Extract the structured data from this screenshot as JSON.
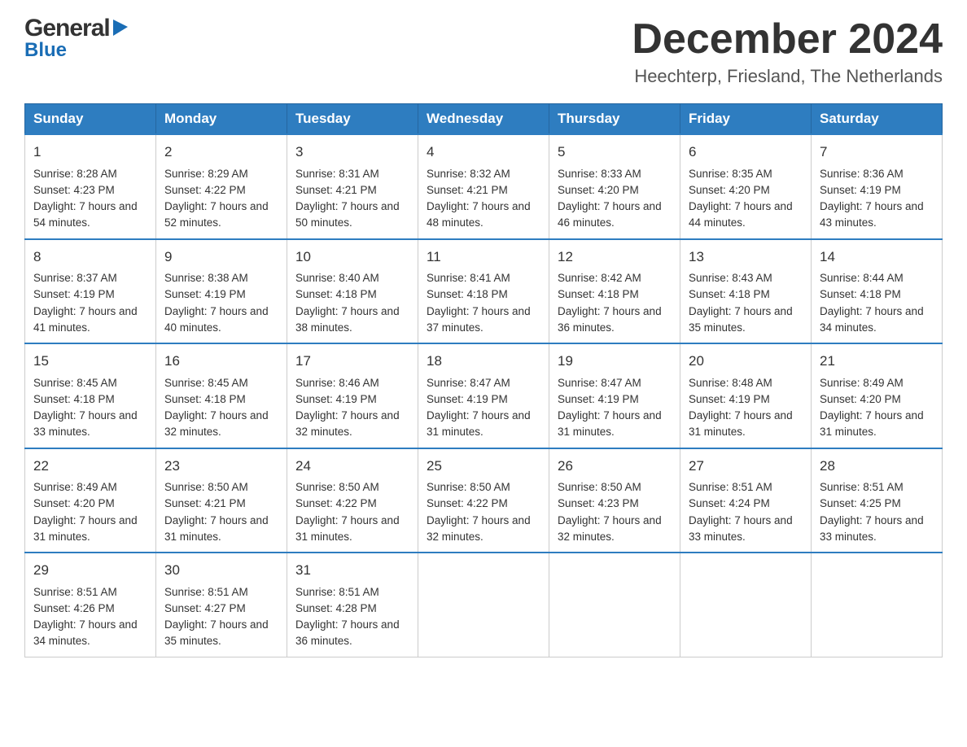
{
  "header": {
    "logo_general": "General",
    "logo_blue": "Blue",
    "month_year": "December 2024",
    "location": "Heechterp, Friesland, The Netherlands"
  },
  "weekdays": [
    "Sunday",
    "Monday",
    "Tuesday",
    "Wednesday",
    "Thursday",
    "Friday",
    "Saturday"
  ],
  "weeks": [
    [
      {
        "day": "1",
        "sunrise": "Sunrise: 8:28 AM",
        "sunset": "Sunset: 4:23 PM",
        "daylight": "Daylight: 7 hours and 54 minutes."
      },
      {
        "day": "2",
        "sunrise": "Sunrise: 8:29 AM",
        "sunset": "Sunset: 4:22 PM",
        "daylight": "Daylight: 7 hours and 52 minutes."
      },
      {
        "day": "3",
        "sunrise": "Sunrise: 8:31 AM",
        "sunset": "Sunset: 4:21 PM",
        "daylight": "Daylight: 7 hours and 50 minutes."
      },
      {
        "day": "4",
        "sunrise": "Sunrise: 8:32 AM",
        "sunset": "Sunset: 4:21 PM",
        "daylight": "Daylight: 7 hours and 48 minutes."
      },
      {
        "day": "5",
        "sunrise": "Sunrise: 8:33 AM",
        "sunset": "Sunset: 4:20 PM",
        "daylight": "Daylight: 7 hours and 46 minutes."
      },
      {
        "day": "6",
        "sunrise": "Sunrise: 8:35 AM",
        "sunset": "Sunset: 4:20 PM",
        "daylight": "Daylight: 7 hours and 44 minutes."
      },
      {
        "day": "7",
        "sunrise": "Sunrise: 8:36 AM",
        "sunset": "Sunset: 4:19 PM",
        "daylight": "Daylight: 7 hours and 43 minutes."
      }
    ],
    [
      {
        "day": "8",
        "sunrise": "Sunrise: 8:37 AM",
        "sunset": "Sunset: 4:19 PM",
        "daylight": "Daylight: 7 hours and 41 minutes."
      },
      {
        "day": "9",
        "sunrise": "Sunrise: 8:38 AM",
        "sunset": "Sunset: 4:19 PM",
        "daylight": "Daylight: 7 hours and 40 minutes."
      },
      {
        "day": "10",
        "sunrise": "Sunrise: 8:40 AM",
        "sunset": "Sunset: 4:18 PM",
        "daylight": "Daylight: 7 hours and 38 minutes."
      },
      {
        "day": "11",
        "sunrise": "Sunrise: 8:41 AM",
        "sunset": "Sunset: 4:18 PM",
        "daylight": "Daylight: 7 hours and 37 minutes."
      },
      {
        "day": "12",
        "sunrise": "Sunrise: 8:42 AM",
        "sunset": "Sunset: 4:18 PM",
        "daylight": "Daylight: 7 hours and 36 minutes."
      },
      {
        "day": "13",
        "sunrise": "Sunrise: 8:43 AM",
        "sunset": "Sunset: 4:18 PM",
        "daylight": "Daylight: 7 hours and 35 minutes."
      },
      {
        "day": "14",
        "sunrise": "Sunrise: 8:44 AM",
        "sunset": "Sunset: 4:18 PM",
        "daylight": "Daylight: 7 hours and 34 minutes."
      }
    ],
    [
      {
        "day": "15",
        "sunrise": "Sunrise: 8:45 AM",
        "sunset": "Sunset: 4:18 PM",
        "daylight": "Daylight: 7 hours and 33 minutes."
      },
      {
        "day": "16",
        "sunrise": "Sunrise: 8:45 AM",
        "sunset": "Sunset: 4:18 PM",
        "daylight": "Daylight: 7 hours and 32 minutes."
      },
      {
        "day": "17",
        "sunrise": "Sunrise: 8:46 AM",
        "sunset": "Sunset: 4:19 PM",
        "daylight": "Daylight: 7 hours and 32 minutes."
      },
      {
        "day": "18",
        "sunrise": "Sunrise: 8:47 AM",
        "sunset": "Sunset: 4:19 PM",
        "daylight": "Daylight: 7 hours and 31 minutes."
      },
      {
        "day": "19",
        "sunrise": "Sunrise: 8:47 AM",
        "sunset": "Sunset: 4:19 PM",
        "daylight": "Daylight: 7 hours and 31 minutes."
      },
      {
        "day": "20",
        "sunrise": "Sunrise: 8:48 AM",
        "sunset": "Sunset: 4:19 PM",
        "daylight": "Daylight: 7 hours and 31 minutes."
      },
      {
        "day": "21",
        "sunrise": "Sunrise: 8:49 AM",
        "sunset": "Sunset: 4:20 PM",
        "daylight": "Daylight: 7 hours and 31 minutes."
      }
    ],
    [
      {
        "day": "22",
        "sunrise": "Sunrise: 8:49 AM",
        "sunset": "Sunset: 4:20 PM",
        "daylight": "Daylight: 7 hours and 31 minutes."
      },
      {
        "day": "23",
        "sunrise": "Sunrise: 8:50 AM",
        "sunset": "Sunset: 4:21 PM",
        "daylight": "Daylight: 7 hours and 31 minutes."
      },
      {
        "day": "24",
        "sunrise": "Sunrise: 8:50 AM",
        "sunset": "Sunset: 4:22 PM",
        "daylight": "Daylight: 7 hours and 31 minutes."
      },
      {
        "day": "25",
        "sunrise": "Sunrise: 8:50 AM",
        "sunset": "Sunset: 4:22 PM",
        "daylight": "Daylight: 7 hours and 32 minutes."
      },
      {
        "day": "26",
        "sunrise": "Sunrise: 8:50 AM",
        "sunset": "Sunset: 4:23 PM",
        "daylight": "Daylight: 7 hours and 32 minutes."
      },
      {
        "day": "27",
        "sunrise": "Sunrise: 8:51 AM",
        "sunset": "Sunset: 4:24 PM",
        "daylight": "Daylight: 7 hours and 33 minutes."
      },
      {
        "day": "28",
        "sunrise": "Sunrise: 8:51 AM",
        "sunset": "Sunset: 4:25 PM",
        "daylight": "Daylight: 7 hours and 33 minutes."
      }
    ],
    [
      {
        "day": "29",
        "sunrise": "Sunrise: 8:51 AM",
        "sunset": "Sunset: 4:26 PM",
        "daylight": "Daylight: 7 hours and 34 minutes."
      },
      {
        "day": "30",
        "sunrise": "Sunrise: 8:51 AM",
        "sunset": "Sunset: 4:27 PM",
        "daylight": "Daylight: 7 hours and 35 minutes."
      },
      {
        "day": "31",
        "sunrise": "Sunrise: 8:51 AM",
        "sunset": "Sunset: 4:28 PM",
        "daylight": "Daylight: 7 hours and 36 minutes."
      },
      {
        "day": "",
        "sunrise": "",
        "sunset": "",
        "daylight": ""
      },
      {
        "day": "",
        "sunrise": "",
        "sunset": "",
        "daylight": ""
      },
      {
        "day": "",
        "sunrise": "",
        "sunset": "",
        "daylight": ""
      },
      {
        "day": "",
        "sunrise": "",
        "sunset": "",
        "daylight": ""
      }
    ]
  ]
}
